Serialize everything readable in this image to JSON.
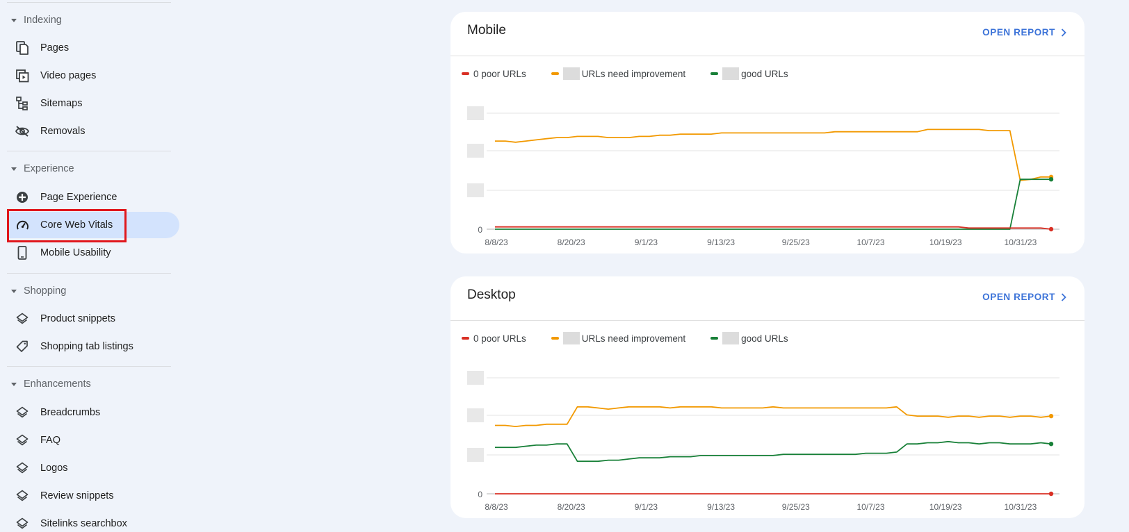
{
  "sidebar": {
    "sections": [
      {
        "label": "Indexing",
        "items": [
          {
            "label": "Pages",
            "icon": "pages-icon"
          },
          {
            "label": "Video pages",
            "icon": "video-pages-icon"
          },
          {
            "label": "Sitemaps",
            "icon": "sitemaps-icon"
          },
          {
            "label": "Removals",
            "icon": "removals-icon"
          }
        ]
      },
      {
        "label": "Experience",
        "items": [
          {
            "label": "Page Experience",
            "icon": "page-experience-icon"
          },
          {
            "label": "Core Web Vitals",
            "icon": "gauge-icon",
            "active": true
          },
          {
            "label": "Mobile Usability",
            "icon": "phone-icon"
          }
        ]
      },
      {
        "label": "Shopping",
        "items": [
          {
            "label": "Product snippets",
            "icon": "layers-icon"
          },
          {
            "label": "Shopping tab listings",
            "icon": "tag-icon"
          }
        ]
      },
      {
        "label": "Enhancements",
        "items": [
          {
            "label": "Breadcrumbs",
            "icon": "layers-icon"
          },
          {
            "label": "FAQ",
            "icon": "layers-icon"
          },
          {
            "label": "Logos",
            "icon": "layers-icon"
          },
          {
            "label": "Review snippets",
            "icon": "layers-icon"
          },
          {
            "label": "Sitelinks searchbox",
            "icon": "layers-icon"
          }
        ]
      }
    ]
  },
  "colors": {
    "poor": "#d93025",
    "needs_improvement": "#f29900",
    "good": "#188038",
    "accent": "#3c73d8"
  },
  "cards": [
    {
      "title": "Mobile",
      "open_report": "OPEN REPORT",
      "legend": {
        "poor": "0 poor URLs",
        "needs_improvement": "URLs need improvement",
        "good": "good URLs"
      }
    },
    {
      "title": "Desktop",
      "open_report": "OPEN REPORT",
      "legend": {
        "poor": "0 poor URLs",
        "needs_improvement": "URLs need improvement",
        "good": "good URLs"
      }
    }
  ],
  "chart_data": [
    {
      "type": "line",
      "x_tick_labels": [
        "8/8/23",
        "8/20/23",
        "9/1/23",
        "9/13/23",
        "9/25/23",
        "10/7/23",
        "10/19/23",
        "10/31/23"
      ],
      "y_tick_labels": [
        "0"
      ],
      "y_axis_values_visible": false,
      "grid": true,
      "legend_placement": "top-left",
      "series": [
        {
          "key": "needs_improvement",
          "values": [
            0.76,
            0.76,
            0.75,
            0.76,
            0.77,
            0.78,
            0.79,
            0.79,
            0.8,
            0.8,
            0.8,
            0.79,
            0.79,
            0.79,
            0.8,
            0.8,
            0.81,
            0.81,
            0.82,
            0.82,
            0.82,
            0.82,
            0.83,
            0.83,
            0.83,
            0.83,
            0.83,
            0.83,
            0.83,
            0.83,
            0.83,
            0.83,
            0.83,
            0.84,
            0.84,
            0.84,
            0.84,
            0.84,
            0.84,
            0.84,
            0.84,
            0.84,
            0.86,
            0.86,
            0.86,
            0.86,
            0.86,
            0.86,
            0.85,
            0.85,
            0.85,
            0.42,
            0.43,
            0.45,
            0.45
          ]
        },
        {
          "key": "good",
          "values": [
            0,
            0,
            0,
            0,
            0,
            0,
            0,
            0,
            0,
            0,
            0,
            0,
            0,
            0,
            0,
            0,
            0,
            0,
            0,
            0,
            0,
            0,
            0,
            0,
            0,
            0,
            0,
            0,
            0,
            0,
            0,
            0,
            0,
            0,
            0,
            0,
            0,
            0,
            0,
            0,
            0,
            0,
            0,
            0,
            0,
            0,
            0,
            0,
            0,
            0,
            0,
            0.43,
            0.43,
            0.43,
            0.43
          ]
        },
        {
          "key": "poor",
          "values": [
            0.02,
            0.02,
            0.02,
            0.02,
            0.02,
            0.02,
            0.02,
            0.02,
            0.02,
            0.02,
            0.02,
            0.02,
            0.02,
            0.02,
            0.02,
            0.02,
            0.02,
            0.02,
            0.02,
            0.02,
            0.02,
            0.02,
            0.02,
            0.02,
            0.02,
            0.02,
            0.02,
            0.02,
            0.02,
            0.02,
            0.02,
            0.02,
            0.02,
            0.02,
            0.02,
            0.02,
            0.02,
            0.02,
            0.02,
            0.02,
            0.02,
            0.02,
            0.02,
            0.02,
            0.02,
            0.02,
            0.01,
            0.01,
            0.01,
            0.01,
            0.01,
            0.01,
            0.01,
            0.01,
            0.0
          ]
        }
      ]
    },
    {
      "type": "line",
      "x_tick_labels": [
        "8/8/23",
        "8/20/23",
        "9/1/23",
        "9/13/23",
        "9/25/23",
        "10/7/23",
        "10/19/23",
        "10/31/23"
      ],
      "y_tick_labels": [
        "0"
      ],
      "y_axis_values_visible": false,
      "grid": true,
      "legend_placement": "top-left",
      "series": [
        {
          "key": "needs_improvement",
          "values": [
            0.59,
            0.59,
            0.58,
            0.59,
            0.59,
            0.6,
            0.6,
            0.6,
            0.75,
            0.75,
            0.74,
            0.73,
            0.74,
            0.75,
            0.75,
            0.75,
            0.75,
            0.74,
            0.75,
            0.75,
            0.75,
            0.75,
            0.74,
            0.74,
            0.74,
            0.74,
            0.74,
            0.75,
            0.74,
            0.74,
            0.74,
            0.74,
            0.74,
            0.74,
            0.74,
            0.74,
            0.74,
            0.74,
            0.74,
            0.75,
            0.68,
            0.67,
            0.67,
            0.67,
            0.66,
            0.67,
            0.67,
            0.66,
            0.67,
            0.67,
            0.66,
            0.67,
            0.67,
            0.66,
            0.67
          ]
        },
        {
          "key": "good",
          "values": [
            0.4,
            0.4,
            0.4,
            0.41,
            0.42,
            0.42,
            0.43,
            0.43,
            0.28,
            0.28,
            0.28,
            0.29,
            0.29,
            0.3,
            0.31,
            0.31,
            0.31,
            0.32,
            0.32,
            0.32,
            0.33,
            0.33,
            0.33,
            0.33,
            0.33,
            0.33,
            0.33,
            0.33,
            0.34,
            0.34,
            0.34,
            0.34,
            0.34,
            0.34,
            0.34,
            0.34,
            0.35,
            0.35,
            0.35,
            0.36,
            0.43,
            0.43,
            0.44,
            0.44,
            0.45,
            0.44,
            0.44,
            0.43,
            0.44,
            0.44,
            0.43,
            0.43,
            0.43,
            0.44,
            0.43
          ]
        },
        {
          "key": "poor",
          "values": [
            0,
            0,
            0,
            0,
            0,
            0,
            0,
            0,
            0,
            0,
            0,
            0,
            0,
            0,
            0,
            0,
            0,
            0,
            0,
            0,
            0,
            0,
            0,
            0,
            0,
            0,
            0,
            0,
            0,
            0,
            0,
            0,
            0,
            0,
            0,
            0,
            0,
            0,
            0,
            0,
            0,
            0,
            0,
            0,
            0,
            0,
            0,
            0,
            0,
            0,
            0,
            0,
            0,
            0,
            0
          ]
        }
      ]
    }
  ]
}
